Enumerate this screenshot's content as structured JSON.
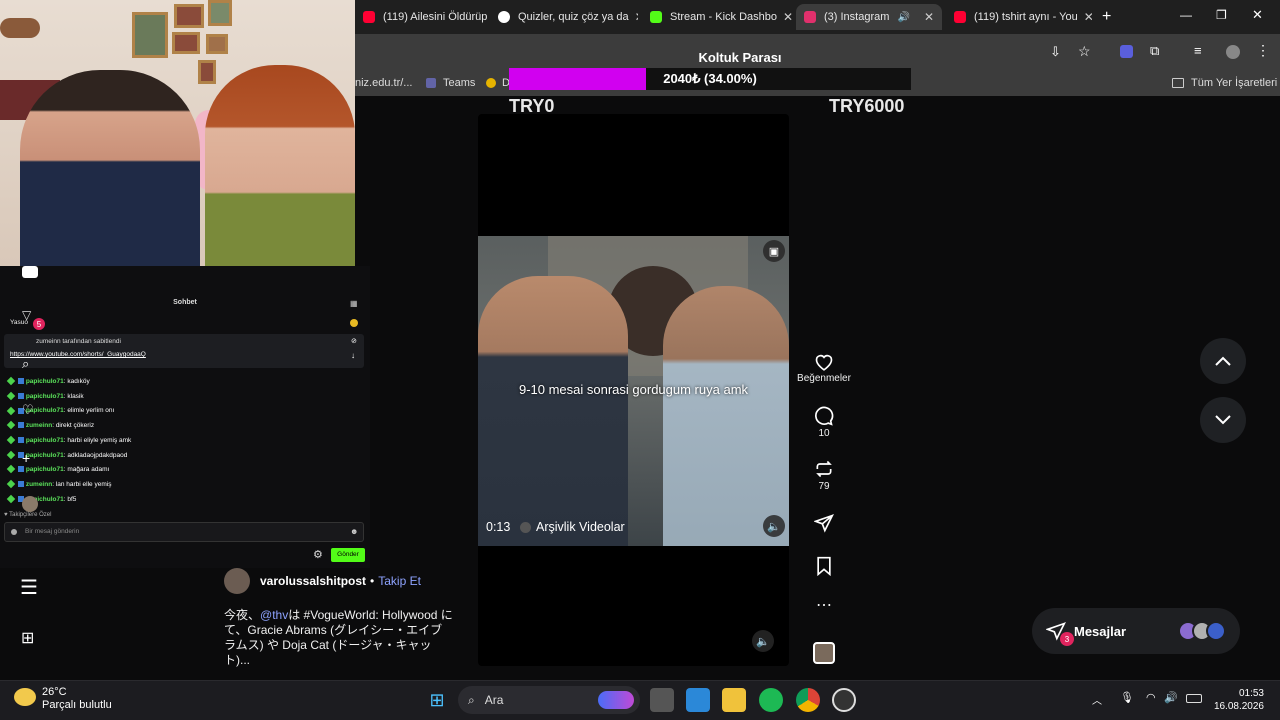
{
  "tabs": [
    {
      "title": "(119) Ailesini Öldürüp",
      "color": "#ff0033"
    },
    {
      "title": "Quizler, quiz çöz ya da",
      "color": "#ffffff"
    },
    {
      "title": "Stream - Kick Dashbo",
      "color": "#53fc18"
    },
    {
      "title": "(3) Instagram",
      "color": "#e1306c"
    },
    {
      "title": "(119) tshirt aynı - You",
      "color": "#ff0033"
    }
  ],
  "bookmarks": {
    "item1": "niz.edu.tr/...",
    "item2": "Teams",
    "item3": "D",
    "all": "Tüm Yer İşaretleri"
  },
  "goal": {
    "title": "Koltuk Parası",
    "text": "2040₺ (34.00%)",
    "progress": 0.34,
    "min": "TRY0",
    "max": "TRY6000",
    "fill_color": "#d100f0"
  },
  "video": {
    "caption": "9-10 mesai sonrasi gordugum ruya amk",
    "time": "0:13",
    "audio": "Arşivlik Videolar"
  },
  "actions": {
    "likes": "Beğenmeler",
    "comments": "10",
    "reposts": "79"
  },
  "messages": {
    "label": "Mesajlar",
    "badge": "3"
  },
  "post": {
    "author": "varolussalshitpost",
    "follow": "Takip Et",
    "mention": "@thv",
    "description_pre": "今夜、",
    "description_post": "は #VogueWorld: Hollywood にて、Gracie Abrams (グレイシー・エイブラムス) や Doja Cat (ドージャ・キャット)..."
  },
  "chat": {
    "title": "Sohbet",
    "pinned_by": "zumeinn tarafından sabitlendi",
    "pinned_link": "https://www.youtube.com/shorts/_GuaygodaaQ",
    "messages": [
      {
        "user": "papichulo71",
        "text": "kadıköy"
      },
      {
        "user": "papichulo71",
        "text": "klasik"
      },
      {
        "user": "papichulo71",
        "text": "elimle yerlim onı"
      },
      {
        "user": "zumeinn",
        "text": "direkt çökeriz"
      },
      {
        "user": "papichulo71",
        "text": "harbi eliyle yemiş amk"
      },
      {
        "user": "papichulo71",
        "text": "adkladaojpdakdpaod"
      },
      {
        "user": "papichulo71",
        "text": "mağara adamı"
      },
      {
        "user": "zumeinn",
        "text": "lan harbi elle yemiş"
      },
      {
        "user": "papichulo71",
        "text": "bf5"
      }
    ],
    "followers_note": "Takipçilere Özel",
    "input_placeholder": "Bir mesaj gönderin",
    "send_label": "Gönder",
    "left_badge": "5",
    "yasuo_label": "Yasuo"
  },
  "taskbar": {
    "search_label": "Ara",
    "temp": "26°C",
    "weather": "Parçalı bulutlu",
    "time": "01:53",
    "date": "16.08.2026"
  }
}
